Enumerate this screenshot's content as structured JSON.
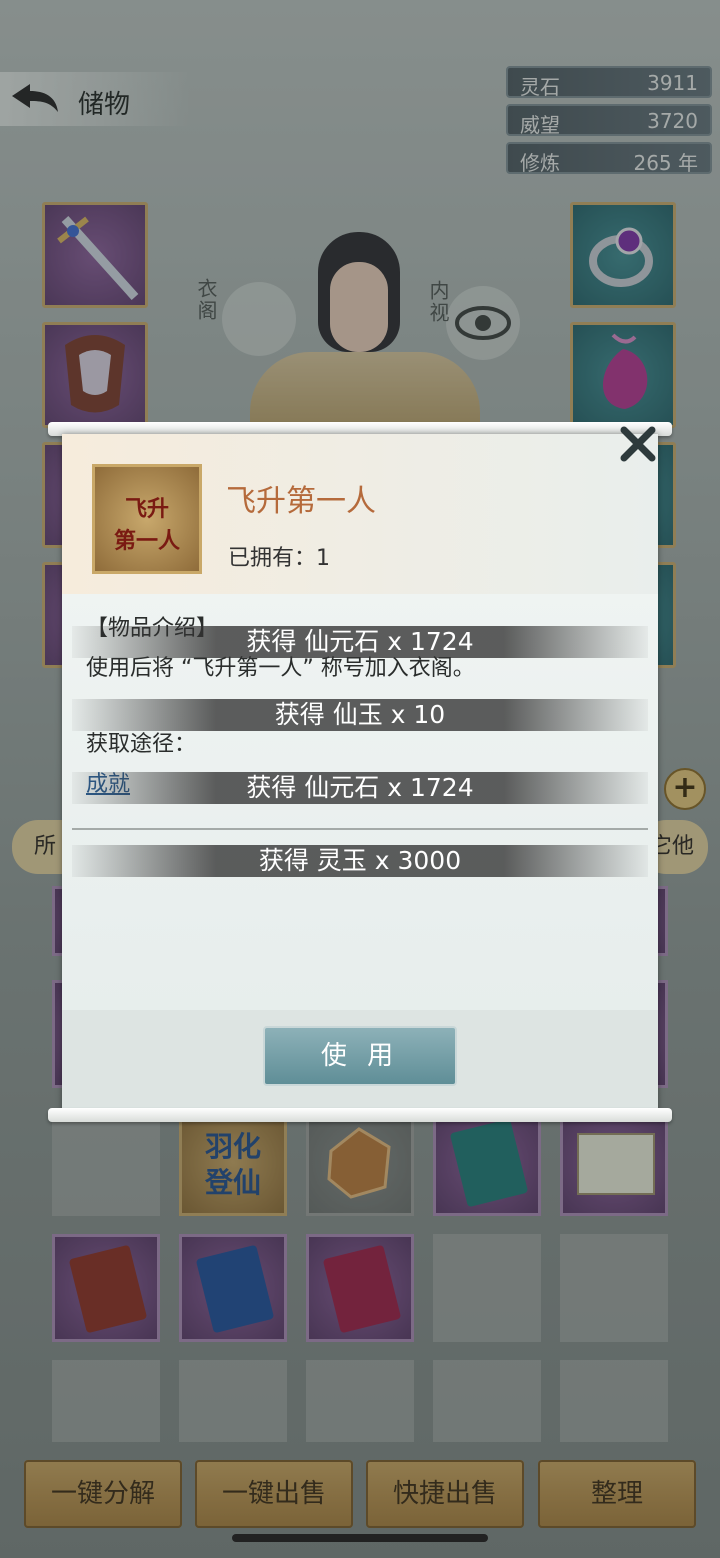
{
  "header": {
    "title": "储物",
    "stats": [
      {
        "label": "灵石",
        "value": "3911"
      },
      {
        "label": "威望",
        "value": "3720"
      },
      {
        "label": "修炼",
        "value": "265 年"
      }
    ],
    "wardrobe_label": "衣阁",
    "inner_view_label": "内视"
  },
  "modal": {
    "item_icon_text_1": "飞升",
    "item_icon_text_2": "第一人",
    "item_name": "飞升第一人",
    "owned": "已拥有：1",
    "intro_heading": "【物品介绍】",
    "intro_text": "使用后将 “飞升第一人” 称号加入衣阁。",
    "source_heading": "获取途径：",
    "source_link": "成就",
    "use_label": "使 用"
  },
  "toasts": [
    "获得 仙元石 x 1724",
    "获得 仙玉 x 10",
    "获得 仙元石 x 1724",
    "获得 灵玉 x 3000"
  ],
  "tabs": {
    "left": "所",
    "right": "它他"
  },
  "bag": {
    "feather_text_1": "羽化",
    "feather_text_2": "登仙"
  },
  "bottom_buttons": [
    "一键分解",
    "一键出售",
    "快捷出售",
    "整理"
  ],
  "colors": {
    "item_name": "#b56a3b",
    "link": "#2b5c8e",
    "button_gold": "#c9a561"
  }
}
